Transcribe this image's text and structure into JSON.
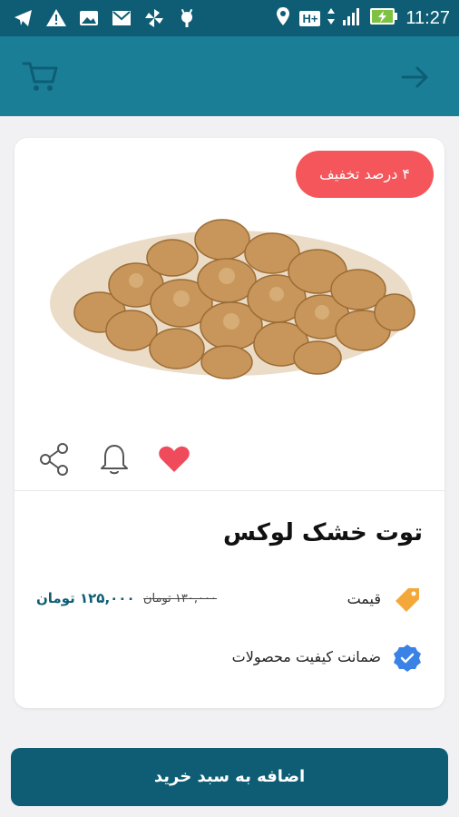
{
  "status_bar": {
    "time": "11:27",
    "network": "H+",
    "left_icons": [
      "telegram-icon",
      "warning-icon",
      "image-icon",
      "mail-icon",
      "pinwheel-icon",
      "android-icon"
    ],
    "right_icons": [
      "location-icon",
      "network-type-icon",
      "signal-icon",
      "battery-charging-icon"
    ]
  },
  "app_bar": {
    "cart_icon": "cart-icon",
    "back_icon": "arrow-right-icon"
  },
  "product": {
    "discount_badge": "۴ درصد تخفیف",
    "title": "توت خشک لوکس",
    "price_label": "قیمت",
    "old_price": "۱۳۰,۰۰۰ تومان",
    "new_price": "۱۲۵,۰۰۰ تومان",
    "quality_label": "ضمانت کیفیت محصولات"
  },
  "actions": {
    "share_icon": "share-icon",
    "notify_icon": "bell-icon",
    "favorite_icon": "heart-icon"
  },
  "cta": {
    "label": "اضافه به سبد خرید"
  },
  "colors": {
    "status_bar": "#0e5d74",
    "app_bar": "#1a7e97",
    "accent": "#0e5d74",
    "discount": "#f4565b",
    "heart": "#ef4b5c",
    "tag": "#f5a83a",
    "verified": "#3b82e6"
  }
}
